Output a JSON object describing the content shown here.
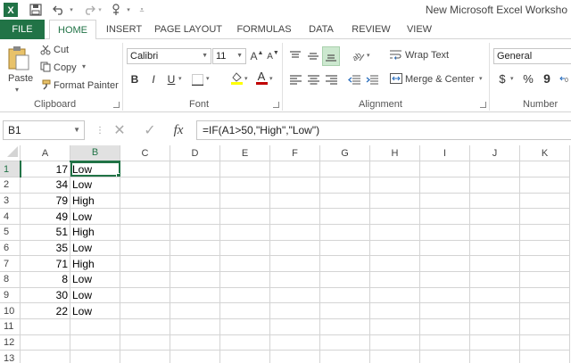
{
  "window": {
    "title": "New Microsoft Excel Worksho"
  },
  "tabs": [
    "FILE",
    "HOME",
    "INSERT",
    "PAGE LAYOUT",
    "FORMULAS",
    "DATA",
    "REVIEW",
    "VIEW"
  ],
  "clipboard": {
    "paste": "Paste",
    "cut": "Cut",
    "copy": "Copy",
    "format_painter": "Format Painter",
    "label": "Clipboard"
  },
  "font": {
    "name": "Calibri",
    "size": "11",
    "grow": "A",
    "shrink": "A",
    "bold": "B",
    "italic": "I",
    "underline": "U",
    "font_color": "A",
    "label": "Font"
  },
  "alignment": {
    "wrap_text": "Wrap Text",
    "merge_center": "Merge & Center",
    "label": "Alignment"
  },
  "number": {
    "format": "General",
    "currency": "$",
    "percent": "%",
    "comma": "9",
    "label": "Number"
  },
  "formula_bar": {
    "name_box": "B1",
    "cancel": "✕",
    "enter": "✓",
    "fx": "fx",
    "formula": "=IF(A1>50,\"High\",\"Low\")"
  },
  "columns": [
    "A",
    "B",
    "C",
    "D",
    "E",
    "F",
    "G",
    "H",
    "I",
    "J",
    "K"
  ],
  "rows": [
    {
      "n": "1",
      "a": "17",
      "b": "Low"
    },
    {
      "n": "2",
      "a": "34",
      "b": "Low"
    },
    {
      "n": "3",
      "a": "79",
      "b": "High"
    },
    {
      "n": "4",
      "a": "49",
      "b": "Low"
    },
    {
      "n": "5",
      "a": "51",
      "b": "High"
    },
    {
      "n": "6",
      "a": "35",
      "b": "Low"
    },
    {
      "n": "7",
      "a": "71",
      "b": "High"
    },
    {
      "n": "8",
      "a": "8",
      "b": "Low"
    },
    {
      "n": "9",
      "a": "30",
      "b": "Low"
    },
    {
      "n": "10",
      "a": "22",
      "b": "Low"
    },
    {
      "n": "11",
      "a": "",
      "b": ""
    },
    {
      "n": "12",
      "a": "",
      "b": ""
    },
    {
      "n": "13",
      "a": "",
      "b": ""
    }
  ],
  "colors": {
    "accent": "#217346",
    "header_selected": "#e1e1e1",
    "gridline": "#d4d4d4"
  }
}
